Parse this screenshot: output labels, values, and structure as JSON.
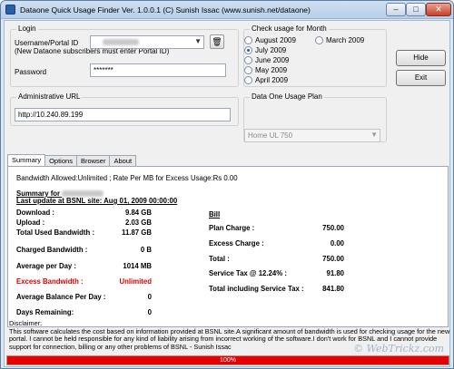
{
  "window": {
    "title": "Dataone Quick Usage Finder Ver. 1.0.0.1  (C) Sunish Issac (www.sunish.net/dataone)"
  },
  "login": {
    "group_label": "Login",
    "username_label": "Username/Portal ID",
    "username_note": "(New Dataone subscribers must enter Portal ID)",
    "password_label": "Password",
    "password_value": "*******"
  },
  "admin": {
    "group_label": "Administrative URL",
    "url_value": "http://10.240.89.199"
  },
  "month": {
    "group_label": "Check usage for Month",
    "options": [
      "August 2009",
      "July 2009",
      "June 2009",
      "May 2009",
      "April 2009",
      "March 2009"
    ],
    "selected": "July 2009"
  },
  "plan": {
    "group_label": "Data One Usage Plan",
    "value": "Home UL 750"
  },
  "buttons": {
    "hide": "Hide",
    "exit": "Exit"
  },
  "tabs": [
    "Summary",
    "Options",
    "Browser",
    "About"
  ],
  "summary": {
    "bandwidth_line": "Bandwidth Allowed:Unlimited ;  Rate Per MB for Excess Usage:Rs 0.00",
    "summary_for": "Summary for",
    "last_update": "Last update at BSNL site: Aug 01, 2009 00:00:00",
    "download_label": "Download   :",
    "download_value": "9.84 GB",
    "upload_label": "Upload   :",
    "upload_value": "2.03 GB",
    "total_used_label": "Total Used Bandwidth :",
    "total_used_value": "11.87 GB",
    "charged_label": "Charged Bandwidth :",
    "charged_value": "0 B",
    "avg_day_label": "Average per Day :",
    "avg_day_value": "1014 MB",
    "excess_label": "Excess Bandwidth :",
    "excess_value": "Unlimited",
    "avg_balance_label": "Average Balance Per Day :",
    "avg_balance_value": "0",
    "days_remaining_label": "Days Remaining:",
    "days_remaining_value": "0"
  },
  "bill": {
    "heading": "Bill",
    "plan_charge_label": "Plan Charge :",
    "plan_charge_value": "750.00",
    "excess_charge_label": "Excess Charge :",
    "excess_charge_value": "0.00",
    "total_label": "Total   :",
    "total_value": "750.00",
    "tax_label": "Service Tax @ 12.24% :",
    "tax_value": "91.80",
    "grand_total_label": "Total including Service Tax :",
    "grand_total_value": "841.80"
  },
  "disclaimer": {
    "heading": "Disclaimer:",
    "text": "This software calculates the cost based on information provided at BSNL site.A significant amount of bandwidth is used for checking usage for the new portal. I cannot be held responsible for any kind of liability arising from incorrect working of the software.I don't work for BSNL and I cannot provide support for connection, billing or any other problems of BSNL - Sunish Issac"
  },
  "progress": {
    "percent": 100,
    "label": "100%"
  },
  "watermark": "© WebTrickz.com"
}
